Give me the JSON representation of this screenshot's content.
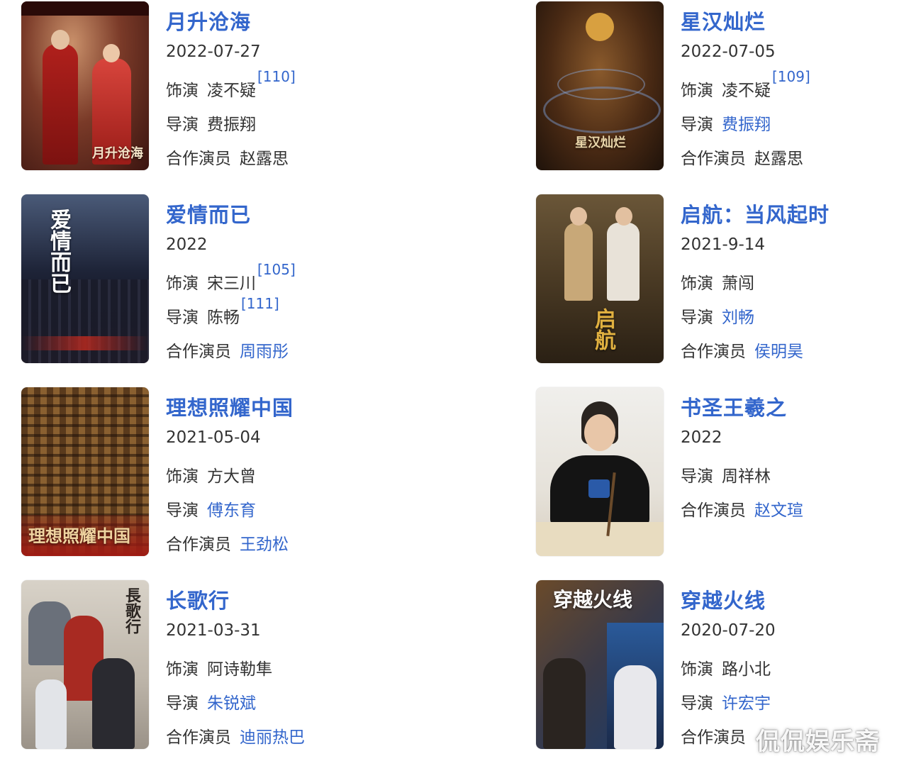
{
  "labels": {
    "role": "饰演",
    "director": "导演",
    "costar": "合作演员"
  },
  "works": [
    {
      "title": "月升沧海",
      "date": "2022-07-27",
      "role": "凌不疑",
      "role_ref": "[110]",
      "director": "费振翔",
      "director_ref": "",
      "costar": "赵露思",
      "poster_text": "月升沧海"
    },
    {
      "title": "星汉灿烂",
      "date": "2022-07-05",
      "role": "凌不疑",
      "role_ref": "[109]",
      "director": "费振翔",
      "director_ref": "",
      "costar": "赵露思",
      "poster_text": "星汉灿烂"
    },
    {
      "title": "爱情而已",
      "date": "2022",
      "role": "宋三川",
      "role_ref": "[105]",
      "director": "陈畅",
      "director_ref": "[111]",
      "costar": "周雨彤",
      "poster_text": "爱情而已"
    },
    {
      "title": "启航：当风起时",
      "date": "2021-9-14",
      "role": "萧闯",
      "role_ref": "",
      "director": "刘畅",
      "director_ref": "",
      "costar": "侯明昊",
      "poster_text": "启航"
    },
    {
      "title": "理想照耀中国",
      "date": "2021-05-04",
      "role": "方大曾",
      "role_ref": "",
      "director": "傅东育",
      "director_ref": "",
      "costar": "王劲松",
      "poster_text": "理想照耀中国"
    },
    {
      "title": "书圣王羲之",
      "date": "2022",
      "director": "周祥林",
      "director_ref": "",
      "costar": "赵文瑄"
    },
    {
      "title": "长歌行",
      "date": "2021-03-31",
      "role": "阿诗勒隼",
      "role_ref": "",
      "director": "朱锐斌",
      "director_ref": "",
      "costar": "迪丽热巴",
      "poster_text": "長歌行"
    },
    {
      "title": "穿越火线",
      "date": "2020-07-20",
      "role": "路小北",
      "role_ref": "",
      "director": "许宏宇",
      "director_ref": "",
      "costar": "",
      "poster_text": "穿越火线"
    }
  ],
  "watermark": "侃侃娱乐斋"
}
